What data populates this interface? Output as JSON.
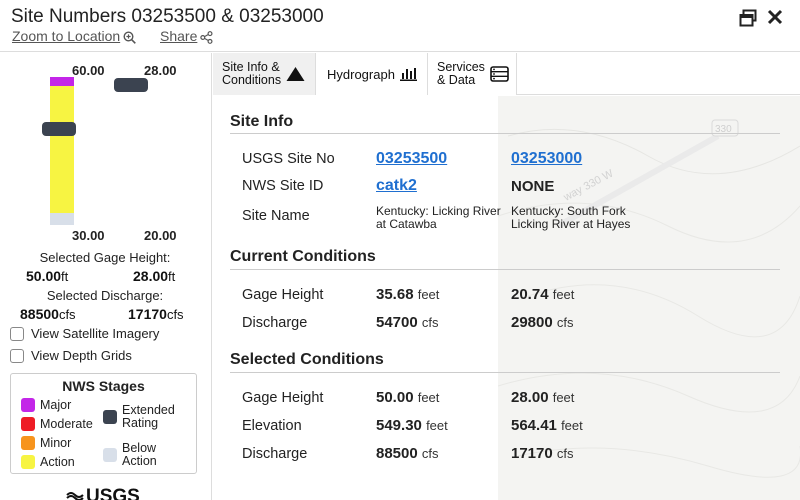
{
  "header": {
    "title": "Site Numbers 03253500 & 03253000",
    "zoom_label": "Zoom to Location",
    "share_label": "Share"
  },
  "gage": {
    "top_left": "60.00",
    "top_right": "28.00",
    "bottom_left": "30.00",
    "bottom_right": "20.00",
    "selected_gage_label": "Selected Gage Height:",
    "selected_gage_left": "50.00",
    "selected_gage_right": "28.00",
    "gage_unit": "ft",
    "selected_discharge_label": "Selected Discharge:",
    "selected_discharge_left": "88500",
    "selected_discharge_right": "17170",
    "discharge_unit": "cfs"
  },
  "options": {
    "satellite_label": "View Satellite Imagery",
    "depth_label": "View Depth Grids"
  },
  "legend": {
    "title": "NWS Stages",
    "items": {
      "major": {
        "label": "Major",
        "color": "#c326e8"
      },
      "moderate": {
        "label": "Moderate",
        "color": "#ee1c25"
      },
      "minor": {
        "label": "Minor",
        "color": "#f7941d"
      },
      "action": {
        "label": "Action",
        "color": "#f7f442"
      },
      "extended": {
        "label_1": "Extended",
        "label_2": "Rating",
        "color": "#3b4350"
      },
      "below": {
        "label_1": "Below",
        "label_2": "Action",
        "color": "#d8dfe9"
      }
    }
  },
  "logo": {
    "text": "USGS"
  },
  "tabs": {
    "info_line1": "Site Info &",
    "info_line2": "Conditions",
    "hydrograph": "Hydrograph",
    "services_line1": "Services",
    "services_line2": "& Data"
  },
  "site_info": {
    "title": "Site Info",
    "usgs_label": "USGS Site No",
    "usgs_1": "03253500",
    "usgs_2": "03253000",
    "nws_label": "NWS Site ID",
    "nws_1": "catk2",
    "nws_2": "NONE",
    "name_label": "Site Name",
    "name_1": "Kentucky: Licking River at Catawba",
    "name_2": "Kentucky: South Fork Licking River at Hayes"
  },
  "current": {
    "title": "Current Conditions",
    "gage_label": "Gage Height",
    "gage_1": "35.68",
    "gage_2": "20.74",
    "gage_unit": "feet",
    "discharge_label": "Discharge",
    "discharge_1": "54700",
    "discharge_2": "29800",
    "discharge_unit": "cfs"
  },
  "selected": {
    "title": "Selected Conditions",
    "gage_label": "Gage Height",
    "gage_1": "50.00",
    "gage_2": "28.00",
    "gage_unit": "feet",
    "elev_label": "Elevation",
    "elev_1": "549.30",
    "elev_2": "564.41",
    "elev_unit": "feet",
    "discharge_label": "Discharge",
    "discharge_1": "88500",
    "discharge_2": "17170",
    "discharge_unit": "cfs"
  },
  "map": {
    "road_label": "way 330  W",
    "shield": "330"
  }
}
